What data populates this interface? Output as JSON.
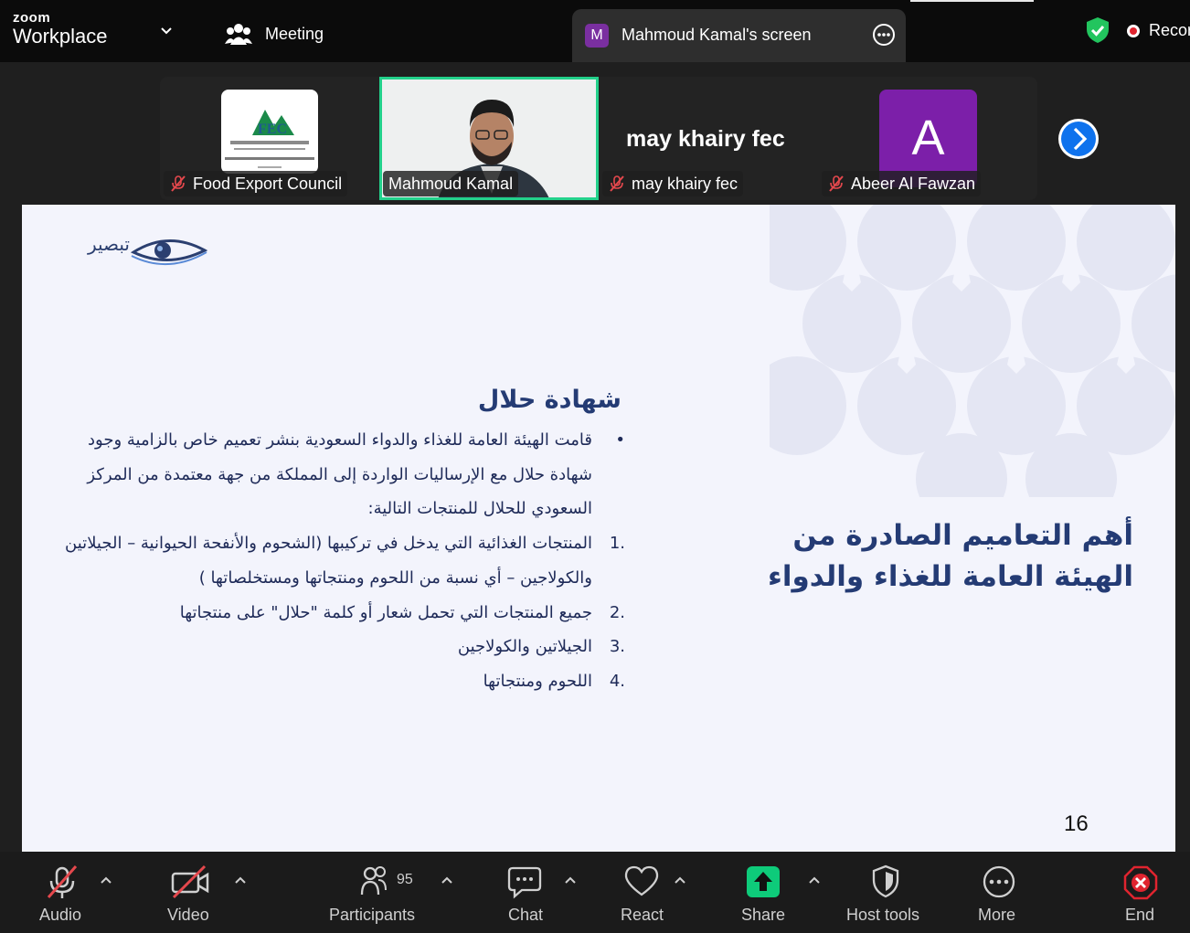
{
  "topbar": {
    "brand_small": "zoom",
    "brand_large": "Workplace",
    "meeting_label": "Meeting",
    "screen_tab_badge": "M",
    "screen_tab_label": "Mahmoud Kamal's screen",
    "record_label": "Recor"
  },
  "gallery": {
    "tiles": [
      {
        "name": "Food Export Council"
      },
      {
        "name": "Mahmoud Kamal"
      },
      {
        "name": "may khairy fec",
        "display": "may khairy fec"
      },
      {
        "name": "Abeer Al Fawzan",
        "avatar_letter": "A"
      }
    ]
  },
  "slide": {
    "logo_ar": "تبصير",
    "logo_en": "Tabseer",
    "title_line1": "أهم التعاميم الصادرة من",
    "title_line2": "الهيئة العامة للغذاء والدواء",
    "heading": "شهادة حلال",
    "bullet": "قامت الهيئة العامة للغذاء والدواء السعودية بنشر تعميم خاص بالزامية وجود شهادة حلال مع الإرساليات الواردة إلى المملكة من جهة معتمدة من المركز السعودي للحلال للمنتجات التالية:",
    "items": [
      {
        "num": ".1",
        "text": "المنتجات الغذائية التي يدخل في تركيبها (الشحوم والأنفحة الحيوانية – الجيلاتين والكولاجين – أي نسبة من اللحوم ومنتجاتها ومستخلصاتها )"
      },
      {
        "num": ".2",
        "text": "جميع المنتجات التي تحمل شعار أو كلمة \"حلال\" على منتجاتها"
      },
      {
        "num": ".3",
        "text": "الجيلاتين والكولاجين"
      },
      {
        "num": ".4",
        "text": "اللحوم ومنتجاتها"
      }
    ],
    "page_number": "16"
  },
  "toolbar": {
    "audio": "Audio",
    "video": "Video",
    "participants": "Participants",
    "participants_count": "95",
    "chat": "Chat",
    "react": "React",
    "share": "Share",
    "host_tools": "Host tools",
    "more": "More",
    "end": "End"
  },
  "colors": {
    "accent_green": "#23d18b",
    "share_green": "#0ecb7a",
    "slide_navy": "#243b74",
    "end_red": "#e0242f",
    "avatar_purple": "#7c1fa9"
  }
}
